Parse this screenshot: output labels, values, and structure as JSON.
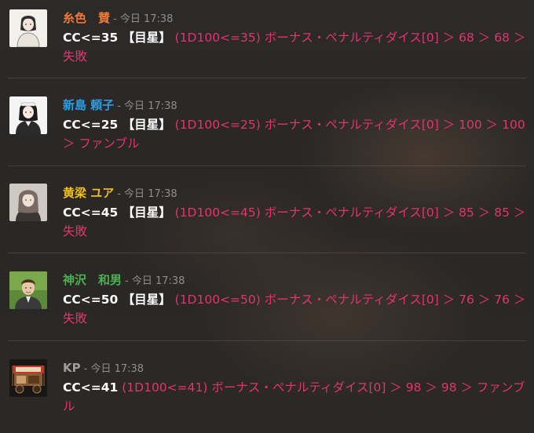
{
  "messages": [
    {
      "speaker": "糸色　賛",
      "speaker_color": "#f07838",
      "meta": "- 今日 17:38",
      "command": "CC<=35 【目星】",
      "result": "(1D100<=35) ボーナス・ペナルティダイス[0] ＞ 68 ＞ 68 ＞ 失敗",
      "avatar_icon": "avatar-portrait-icon"
    },
    {
      "speaker": "新島 頼子",
      "speaker_color": "#2a9fe8",
      "meta": "- 今日 17:38",
      "command": "CC<=25 【目星】",
      "result": "(1D100<=25) ボーナス・ペナルティダイス[0] ＞ 100 ＞ 100 ＞ ファンブル",
      "avatar_icon": "avatar-portrait-icon"
    },
    {
      "speaker": "黄梁 ユア",
      "speaker_color": "#f0c020",
      "meta": "- 今日 17:38",
      "command": "CC<=45 【目星】",
      "result": "(1D100<=45) ボーナス・ペナルティダイス[0] ＞ 85 ＞ 85 ＞ 失敗",
      "avatar_icon": "avatar-portrait-icon"
    },
    {
      "speaker": "神沢　和男",
      "speaker_color": "#4caf50",
      "meta": "- 今日 17:38",
      "command": "CC<=50 【目星】",
      "result": "(1D100<=50) ボーナス・ペナルティダイス[0] ＞ 76 ＞ 76 ＞ 失敗",
      "avatar_icon": "avatar-portrait-icon"
    },
    {
      "speaker": "KP",
      "speaker_color": "#9e9e9e",
      "meta": "- 今日 17:38",
      "command": "CC<=41",
      "result": "(1D100<=41) ボーナス・ペナルティダイス[0] ＞ 98 ＞ 98 ＞ ファンブル",
      "avatar_icon": "food-cart-icon"
    }
  ]
}
